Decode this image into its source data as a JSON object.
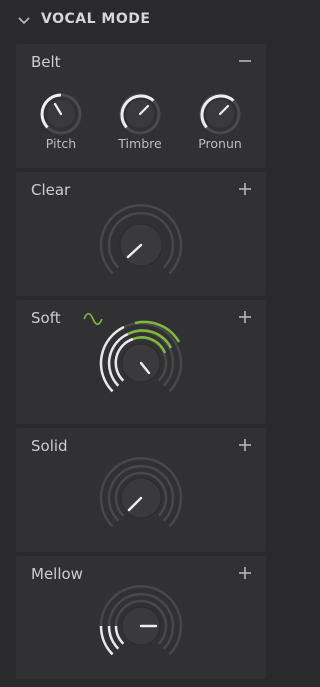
{
  "panel": {
    "title": "VOCAL MODE",
    "collapse_icon": "chevron-down-icon"
  },
  "modes": [
    {
      "label": "Belt",
      "state": "expanded",
      "toggle_icon": "minus-icon",
      "knobs": [
        {
          "label": "Pitch"
        },
        {
          "label": "Timbre"
        },
        {
          "label": "Pronun"
        }
      ]
    },
    {
      "label": "Clear",
      "state": "collapsed",
      "toggle_icon": "plus-icon"
    },
    {
      "label": "Soft",
      "state": "collapsed",
      "toggle_icon": "plus-icon",
      "indicator_icon": "sine-wave-icon"
    },
    {
      "label": "Solid",
      "state": "collapsed",
      "toggle_icon": "plus-icon"
    },
    {
      "label": "Mellow",
      "state": "collapsed",
      "toggle_icon": "plus-icon"
    }
  ],
  "colors": {
    "background": "#2a2a2d",
    "card": "#313134",
    "ring_inactive": "#48484c",
    "ring_active_white": "#e8e8ea",
    "accent_green": "#7fb83a"
  }
}
